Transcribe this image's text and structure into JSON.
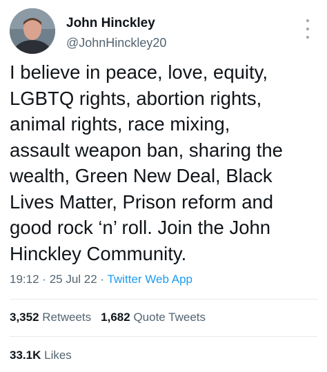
{
  "author": {
    "display_name": "John Hinckley",
    "handle": "@JohnHinckley20",
    "avatar_icon": "profile-photo"
  },
  "menu_icon": "more-vertical-icon",
  "tweet": {
    "text": "I believe in peace, love, equity,\nLGBTQ rights, abortion rights,\nanimal rights, race mixing,\nassault weapon ban, sharing the\nwealth, Green New Deal, Black\nLives Matter, Prison reform and\ngood rock ‘n’ roll. Join the John\nHinckley Community.",
    "time": "19:12",
    "separator": "·",
    "date": "25 Jul 22",
    "source": "Twitter Web App"
  },
  "stats": {
    "retweets_count": "3,352",
    "retweets_label": "Retweets",
    "quotes_count": "1,682",
    "quotes_label": "Quote Tweets",
    "likes_count": "33.1K",
    "likes_label": "Likes"
  },
  "colors": {
    "text": "#0f1419",
    "secondary": "#536471",
    "link": "#1d9bf0",
    "divider": "#e7e9ea"
  }
}
